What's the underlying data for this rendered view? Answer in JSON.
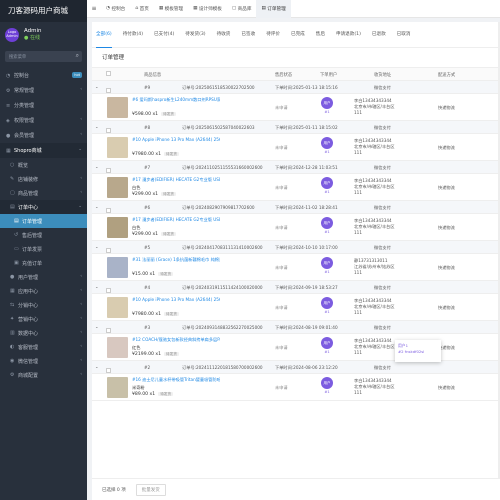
{
  "app": {
    "brand": "刀客源码用户商城"
  },
  "user": {
    "avatar_text": "Logo Admin",
    "name": "Admin",
    "status": "● 在线"
  },
  "search": {
    "placeholder": "搜索菜单"
  },
  "sidebar": {
    "items": [
      {
        "label": "控制台",
        "badge": "hot",
        "icon": "speedometer-icon"
      },
      {
        "label": "常规管理",
        "icon": "cog-icon"
      },
      {
        "label": "分类管理",
        "icon": "list-icon"
      },
      {
        "label": "权限管理",
        "icon": "group-icon"
      },
      {
        "label": "会员管理",
        "icon": "user-icon"
      },
      {
        "label": "Shopro商城",
        "icon": "shop-icon"
      }
    ],
    "shop_items": [
      {
        "label": "概览"
      },
      {
        "label": "店铺装修"
      },
      {
        "label": "商品管理"
      },
      {
        "label": "订单中心"
      }
    ],
    "order_items": [
      {
        "label": "订单管理"
      },
      {
        "label": "售后管理"
      },
      {
        "label": "订单发票"
      },
      {
        "label": "充值订单"
      }
    ],
    "rest_items": [
      {
        "label": "用户管理"
      },
      {
        "label": "应用中心"
      },
      {
        "label": "分销中心"
      },
      {
        "label": "营销中心"
      },
      {
        "label": "数据中心"
      },
      {
        "label": "客服管理"
      },
      {
        "label": "微信管理"
      },
      {
        "label": "商城配置"
      }
    ]
  },
  "topbar": {
    "tabs": [
      "控制台",
      "首页",
      "模板管理",
      "设计师模板",
      "商品库",
      "订单管理"
    ]
  },
  "tabs": [
    "全部(6)",
    "待付款(4)",
    "已支付(4)",
    "待发货(3)",
    "待收货",
    "已签收",
    "待评价",
    "已完成",
    "售后",
    "申请退款(1)",
    "已退款",
    "已取消"
  ],
  "panel": {
    "title": "订单管理"
  },
  "table": {
    "headers": {
      "goods": "商品信息",
      "pay_status": "售后状态",
      "buyer": "下单用户",
      "address": "收货地址",
      "ship": "配送方式"
    }
  },
  "orders": [
    {
      "idx": "#9",
      "order_no": "订单号:2025061518530022702500",
      "time": "下单时间:2025-01-13 18:15:16",
      "pay": "微信支付",
      "product": "#6 爱玛斯haspro新生L240mm散口剂RPSU家(演绎版...",
      "spec": "",
      "price": "¥598.00",
      "qty": "x1",
      "tag": "待发货",
      "pstat": "未申请",
      "buyer_av": "用户",
      "buyer_id": "#1",
      "addr1": "李白13434343344",
      "addr2": "北京市/市辖区/丰台区",
      "addr3": "111",
      "ship": "快递物流",
      "thumb": "#c9b7a0"
    },
    {
      "idx": "#8",
      "order_no": "订单号:2025061502587040022603",
      "time": "下单时间:2025-01-11 18:15:02",
      "pay": "微信支付",
      "product": "#10 Apple iPhone 13 Pro Max (A2644) 256GB 香槟...",
      "spec": "",
      "price": "¥7980.00",
      "qty": "x1",
      "tag": "待发货",
      "pstat": "未申请",
      "buyer_av": "用户",
      "buyer_id": "#1",
      "addr1": "李白13434343344",
      "addr2": "北京市/市辖区/丰台区",
      "addr3": "111",
      "ship": "快递物流",
      "thumb": "#d9ccb0"
    },
    {
      "idx": "#7",
      "order_no": "订单号:2024110251155531660002600",
      "time": "下单时间:2024-12-28 11:03:51",
      "pay": "微信支付",
      "product": "#17 漫步者(EDIFIER) HECATE G2专业版 USB7.1声道...",
      "spec": "白色",
      "price": "¥299.00",
      "qty": "x1",
      "tag": "待发货",
      "pstat": "未申请",
      "buyer_av": "用户",
      "buyer_id": "#1",
      "addr1": "李白13434343344",
      "addr2": "北京市/市辖区/丰台区",
      "addr3": "111",
      "ship": "快递物流",
      "thumb": "#b8a88c"
    },
    {
      "idx": "#6",
      "order_no": "订单号:2024082907909817702600",
      "time": "下单时间:2024-11-02 18:28:41",
      "pay": "微信支付",
      "product": "#17 漫步者(EDIFIER) HECATE G2专业版 USB7.1声道...",
      "spec": "白色",
      "price": "¥299.00",
      "qty": "x1",
      "tag": "待发货",
      "pstat": "未申请",
      "buyer_av": "用户",
      "buyer_id": "#1",
      "addr1": "李白13434343344",
      "addr2": "北京市/市辖区/丰台区",
      "addr3": "111",
      "ship": "快递物流",
      "thumb": "#b0a080"
    },
    {
      "idx": "#5",
      "order_no": "订单号:2024041708311131410002600",
      "time": "下单时间:2024-10-10 10:17:00",
      "pay": "微信支付",
      "product": "#31 法丽丽 (Grace) 1条抗菌新疆棉毛巾 纯棉柔软家...",
      "spec": "",
      "price": "¥15.00",
      "qty": "x1",
      "tag": "待发货",
      "pstat": "未申请",
      "buyer_av": "用户",
      "buyer_id": "#1",
      "addr1": "静13731313011",
      "addr2": "江苏省/苏州市/姑苏区",
      "addr3": "111",
      "ship": "快递物流",
      "thumb": "#a9b3c8"
    },
    {
      "idx": "#4",
      "order_no": "订单号:2024031911511424100020000",
      "time": "下单时间:2024-09-19 18:53:27",
      "pay": "微信支付",
      "product": "#10 Apple iPhone 13 Pro Max (A2644) 256GB 香槟...",
      "spec": "",
      "price": "¥7980.00",
      "qty": "x1",
      "tag": "待发货",
      "pstat": "未申请",
      "buyer_av": "用户",
      "buyer_id": "#1",
      "addr1": "李白13434343344",
      "addr2": "北京市/市辖区/丰台区",
      "addr3": "111",
      "ship": "快递物流",
      "thumb": "#d9ccb0"
    },
    {
      "idx": "#3",
      "order_no": "订单号:2024093148832562270025000",
      "time": "下单时间:2024-08-19 09:01:40",
      "pay": "微信支付",
      "product": "#12 COACH/蔻驰女包新款经典斜挎单肩多层Parker女士...",
      "spec": "红色",
      "price": "¥2199.00",
      "qty": "x1",
      "tag": "待发货",
      "pstat": "未申请",
      "buyer_av": "用户",
      "buyer_id": "#1",
      "addr1": "李白13434343344",
      "addr2": "北京市/市辖区/丰台区",
      "addr3": "111",
      "ship": "快递物流",
      "thumb": "#d8c8c0"
    },
    {
      "idx": "#2",
      "order_no": "订单号:2024111220181580700002600",
      "time": "下单时间:2024-08-06 23:12:20",
      "pay": "微信支付",
      "product": "#16 迪士尼儿童水杯带吸管Tritan婴童吸管防呛背带...",
      "spec": "米奇粉",
      "price": "¥89.00",
      "qty": "x1",
      "tag": "待发货",
      "pstat": "未申请",
      "buyer_av": "用户",
      "buyer_id": "#1",
      "addr1": "李白13434343344",
      "addr2": "北京市/市辖区/丰台区",
      "addr3": "111",
      "ship": "快递物流",
      "thumb": "#c8c0a8"
    }
  ],
  "popup": {
    "line1": "用户1",
    "line2": "#2 fnskdf02sl"
  },
  "footer": {
    "selected": "已选择 0 项",
    "bulk": "批量发货"
  }
}
